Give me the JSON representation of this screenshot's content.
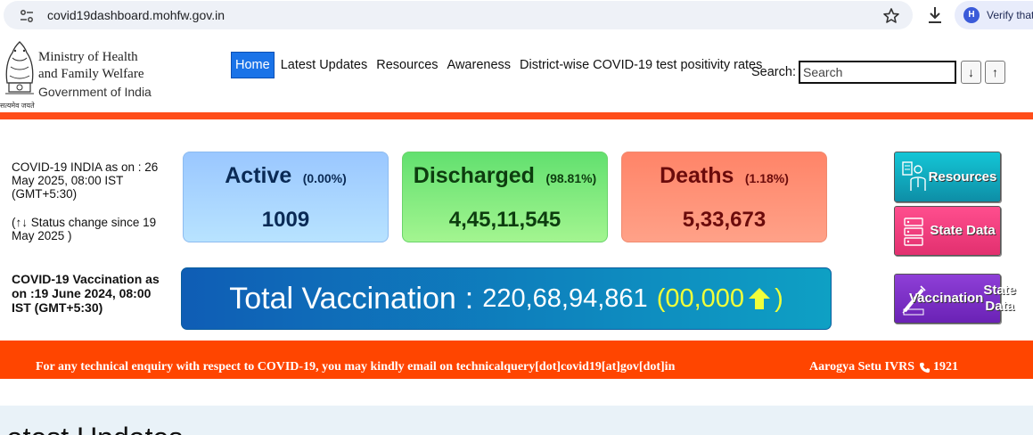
{
  "browser": {
    "url": "covid19dashboard.mohfw.gov.in",
    "verify_badge": "H",
    "verify_label": "Verify that"
  },
  "header": {
    "emblem_caption": "सत्यमेव जयते",
    "ministry_line1": "Ministry of Health",
    "ministry_line2": "and Family Welfare",
    "government": "Government of India",
    "nav": [
      {
        "label": "Home"
      },
      {
        "label": "Latest Updates"
      },
      {
        "label": "Resources"
      },
      {
        "label": "Awareness"
      },
      {
        "label": "District-wise COVID-19 test positivity rates"
      }
    ],
    "search_label": "Search:",
    "search_placeholder": "Search",
    "down_arrow": "↓",
    "up_arrow": "↑"
  },
  "status": {
    "as_of": "COVID-19 INDIA as on : 26 May 2025, 08:00 IST (GMT+5:30)",
    "change_note": "(↑↓ Status change since 19 May 2025 )"
  },
  "cards": {
    "active": {
      "label": "Active",
      "pct": "(0.00%)",
      "value": "1009"
    },
    "discharged": {
      "label": "Discharged",
      "pct": "(98.81%)",
      "value": "4,45,11,545"
    },
    "deaths": {
      "label": "Deaths",
      "pct": "(1.18%)",
      "value": "5,33,673"
    }
  },
  "side_buttons": {
    "resources": "Resources",
    "state_data": "State Data",
    "vaccination_line1": "Vaccination",
    "vaccination_line2": "State Data"
  },
  "vaccination": {
    "as_of": "COVID-19 Vaccination as on :19 June 2024, 08:00 IST (GMT+5:30)",
    "label": "Total Vaccination",
    "colon": ":",
    "value": "220,68,94,861",
    "delta_open": "(00,000",
    "delta_close": ")"
  },
  "info_bar": {
    "enquiry": "For any technical enquiry with respect to COVID-19, you may kindly email on technicalquery[dot]covid19[at]gov[dot]in",
    "ivrs_label": "Aarogya Setu IVRS",
    "ivrs_number": "1921"
  },
  "updates": {
    "title": "Latest Updates"
  },
  "colors": {
    "accent_orange": "#ff4500",
    "nav_active": "#1a73e8",
    "vacc_delta": "#f0ff3a"
  }
}
